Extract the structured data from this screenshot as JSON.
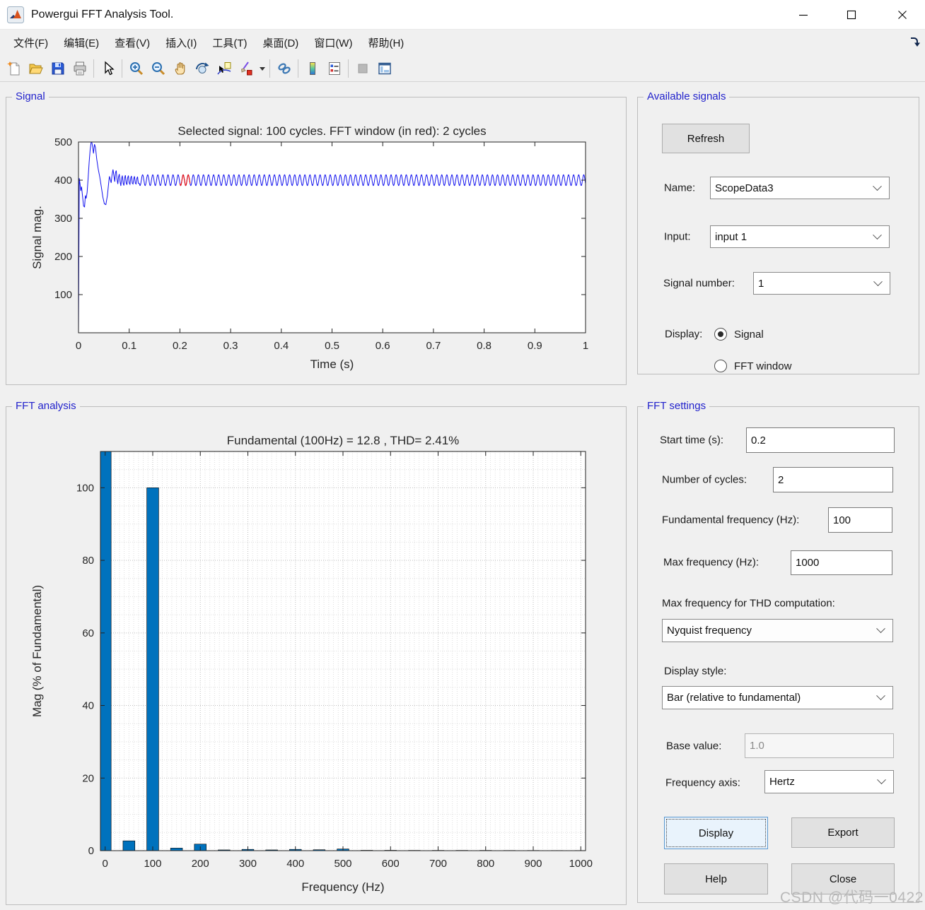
{
  "window": {
    "title": "Powergui FFT Analysis Tool."
  },
  "menu": {
    "items": [
      {
        "label": "文件(F)"
      },
      {
        "label": "编辑(E)"
      },
      {
        "label": "查看(V)"
      },
      {
        "label": "插入(I)"
      },
      {
        "label": "工具(T)"
      },
      {
        "label": "桌面(D)"
      },
      {
        "label": "窗口(W)"
      },
      {
        "label": "帮助(H)"
      }
    ]
  },
  "toolbar": {
    "icons": [
      "new-document",
      "open-folder",
      "save",
      "print",
      "cursor",
      "zoom-in",
      "zoom-out",
      "pan-hand",
      "rotate-3d",
      "data-cursor",
      "brush",
      "brush-dropdown",
      "link-plots",
      "insert-colorbar",
      "insert-legend",
      "hide-plot-tools",
      "show-plot-tools"
    ]
  },
  "colors": {
    "panel_label": "#2222cc",
    "signal_line": "#1212ee",
    "fft_window_segment": "#e81414",
    "bar_fill": "#0072bd",
    "accent_button_border": "#5a97cf"
  },
  "panels": {
    "signal": {
      "label": "Signal"
    },
    "available_signals": {
      "label": "Available signals",
      "refresh_label": "Refresh",
      "name_label": "Name:",
      "name_value": "ScopeData3",
      "input_label": "Input:",
      "input_value": "input 1",
      "signal_number_label": "Signal number:",
      "signal_number_value": "1",
      "display_label": "Display:",
      "radio_signal_label": "Signal",
      "radio_signal_selected": true,
      "radio_fft_label": "FFT window",
      "radio_fft_selected": false
    },
    "fft_analysis": {
      "label": "FFT analysis"
    },
    "fft_settings": {
      "label": "FFT settings",
      "start_time_label": "Start time (s):",
      "start_time_value": "0.2",
      "cycles_label": "Number of cycles:",
      "cycles_value": "2",
      "fundamental_label": "Fundamental frequency (Hz):",
      "fundamental_value": "100",
      "max_freq_label": "Max frequency (Hz):",
      "max_freq_value": "1000",
      "thd_label": "Max frequency for THD computation:",
      "thd_value": "Nyquist frequency",
      "display_style_label": "Display style:",
      "display_style_value": "Bar (relative to fundamental)",
      "base_value_label": "Base value:",
      "base_value_value": "1.0",
      "freq_axis_label": "Frequency axis:",
      "freq_axis_value": "Hertz",
      "display_button": "Display",
      "export_button": "Export",
      "help_button": "Help",
      "close_button": "Close"
    }
  },
  "watermark": "CSDN @代码一0422",
  "chart_data": [
    {
      "type": "line",
      "title": "Selected signal: 100 cycles. FFT window (in red): 2 cycles",
      "xlabel": "Time (s)",
      "ylabel": "Signal mag.",
      "xlim": [
        0,
        1
      ],
      "ylim": [
        0,
        500
      ],
      "xticks": [
        0,
        0.1,
        0.2,
        0.3,
        0.4,
        0.5,
        0.6,
        0.7,
        0.8,
        0.9,
        1
      ],
      "xtick_labels": [
        "0",
        "0.1",
        "0.2",
        "0.3",
        "0.4",
        "0.5",
        "0.6",
        "0.7",
        "0.8",
        "0.9",
        "1"
      ],
      "yticks": [
        100,
        200,
        300,
        400,
        500
      ],
      "ytick_labels": [
        "100",
        "200",
        "300",
        "400",
        "500"
      ],
      "grid": false,
      "line_color": "#1212ee",
      "window_color": "#e81414",
      "fft_window": [
        0.2,
        0.22
      ],
      "steady_state": {
        "mean": 400,
        "amplitude": 14,
        "frequency_hz": 100,
        "phase_rad": 3.8,
        "start_time": 0.12,
        "end_time": 1.0
      },
      "transient_points": [
        [
          0,
          0
        ],
        [
          0.0015,
          405
        ],
        [
          0.003,
          390
        ],
        [
          0.0045,
          372
        ],
        [
          0.006,
          383
        ],
        [
          0.008,
          358
        ],
        [
          0.01,
          332
        ],
        [
          0.012,
          330
        ],
        [
          0.0135,
          360
        ],
        [
          0.015,
          352
        ],
        [
          0.017,
          368
        ],
        [
          0.019,
          405
        ],
        [
          0.021,
          448
        ],
        [
          0.023,
          480
        ],
        [
          0.0255,
          505
        ],
        [
          0.028,
          486
        ],
        [
          0.0295,
          470
        ],
        [
          0.0315,
          494
        ],
        [
          0.0335,
          486
        ],
        [
          0.036,
          455
        ],
        [
          0.039,
          428
        ],
        [
          0.042,
          408
        ],
        [
          0.045,
          382
        ],
        [
          0.048,
          356
        ],
        [
          0.051,
          338
        ],
        [
          0.054,
          336
        ],
        [
          0.057,
          360
        ],
        [
          0.059,
          386
        ],
        [
          0.061,
          410
        ],
        [
          0.063,
          400
        ],
        [
          0.0645,
          393
        ],
        [
          0.066,
          412
        ],
        [
          0.068,
          428
        ],
        [
          0.07,
          410
        ],
        [
          0.0715,
          396
        ],
        [
          0.073,
          420
        ],
        [
          0.0745,
          425
        ],
        [
          0.076,
          402
        ],
        [
          0.0775,
          390
        ],
        [
          0.079,
          408
        ],
        [
          0.0805,
          416
        ],
        [
          0.082,
          396
        ],
        [
          0.0835,
          385
        ],
        [
          0.085,
          404
        ],
        [
          0.0865,
          412
        ],
        [
          0.088,
          392
        ],
        [
          0.0895,
          386
        ],
        [
          0.091,
          406
        ],
        [
          0.0925,
          413
        ],
        [
          0.094,
          393
        ],
        [
          0.0955,
          388
        ],
        [
          0.097,
          406
        ],
        [
          0.0985,
          412
        ],
        [
          0.1,
          393
        ],
        [
          0.1015,
          389
        ],
        [
          0.103,
          406
        ],
        [
          0.1045,
          411
        ],
        [
          0.106,
          392
        ],
        [
          0.1075,
          390
        ],
        [
          0.109,
          405
        ],
        [
          0.1105,
          410
        ],
        [
          0.112,
          392
        ],
        [
          0.1135,
          390
        ],
        [
          0.115,
          404
        ],
        [
          0.1165,
          409
        ],
        [
          0.118,
          392
        ],
        [
          0.1195,
          391
        ],
        [
          0.12,
          392
        ]
      ]
    },
    {
      "type": "bar",
      "title": "Fundamental (100Hz) = 12.8 , THD= 2.41%",
      "xlabel": "Frequency (Hz)",
      "ylabel": "Mag (% of Fundamental)",
      "xlim": [
        -10,
        1010
      ],
      "ylim": [
        0,
        110
      ],
      "xticks": [
        0,
        100,
        200,
        300,
        400,
        500,
        600,
        700,
        800,
        900,
        1000
      ],
      "xtick_labels": [
        "0",
        "100",
        "200",
        "300",
        "400",
        "500",
        "600",
        "700",
        "800",
        "900",
        "1000"
      ],
      "yticks": [
        0,
        20,
        40,
        60,
        80,
        100
      ],
      "ytick_labels": [
        "0",
        "20",
        "40",
        "60",
        "80",
        "100"
      ],
      "grid": true,
      "minor_grid": {
        "x": 10,
        "y": 5
      },
      "bar_color": "#0072bd",
      "bar_edge_color": "#000000",
      "categories": [
        0,
        50,
        100,
        150,
        200,
        250,
        300,
        350,
        400,
        450,
        500,
        550,
        600,
        650,
        700,
        750,
        800,
        850,
        900,
        950,
        1000
      ],
      "values": [
        110,
        2.7,
        100,
        0.7,
        1.8,
        0.2,
        0.35,
        0.2,
        0.35,
        0.25,
        0.45,
        0.1,
        0.1,
        0.08,
        0.08,
        0.08,
        0.08,
        0.06,
        0.06,
        0.05,
        0.05
      ],
      "note": "0 Hz (DC) bar is clipped at the top of the axes"
    }
  ]
}
